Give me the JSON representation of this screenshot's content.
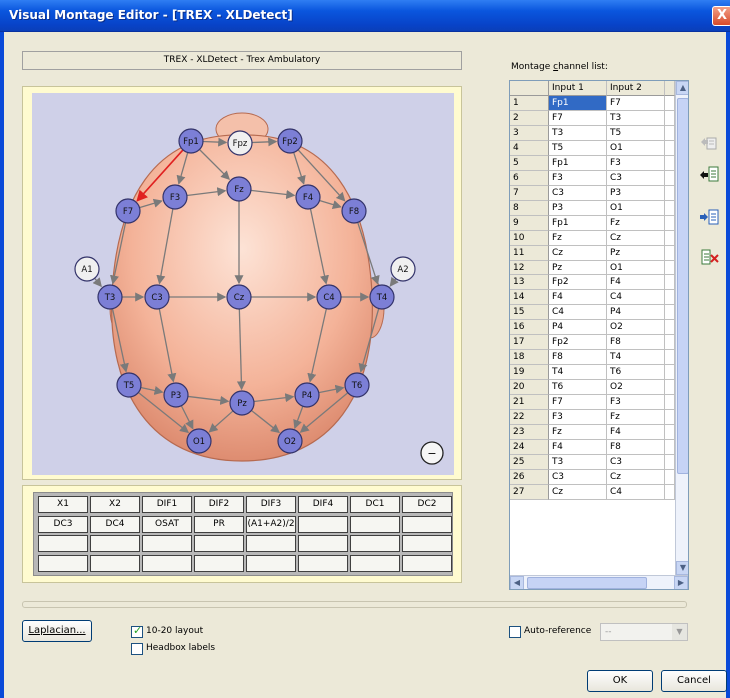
{
  "window": {
    "title": "Visual Montage Editor - [TREX - XLDetect]",
    "close_glyph": "X"
  },
  "headbox_name": "TREX - XLDetect - Trex Ambulatory",
  "colors": {
    "electrode_fill": "#7c7fd6",
    "electrode_ref_fill": "#f0f0f0",
    "head_fill": "#f4b399",
    "canvas_bg": "#cfd0e8",
    "selection": "#316ac5",
    "arrow": "#7a7a7a",
    "arrow_highlight": "#e02020"
  },
  "electrodes": [
    {
      "label": "Fp1",
      "kind": "active"
    },
    {
      "label": "Fpz",
      "kind": "reference"
    },
    {
      "label": "Fp2",
      "kind": "active"
    },
    {
      "label": "F7",
      "kind": "active"
    },
    {
      "label": "F3",
      "kind": "active"
    },
    {
      "label": "Fz",
      "kind": "active"
    },
    {
      "label": "F4",
      "kind": "active"
    },
    {
      "label": "F8",
      "kind": "active"
    },
    {
      "label": "A1",
      "kind": "reference"
    },
    {
      "label": "A2",
      "kind": "reference"
    },
    {
      "label": "T3",
      "kind": "active"
    },
    {
      "label": "C3",
      "kind": "active"
    },
    {
      "label": "Cz",
      "kind": "active"
    },
    {
      "label": "C4",
      "kind": "active"
    },
    {
      "label": "T4",
      "kind": "active"
    },
    {
      "label": "T5",
      "kind": "active"
    },
    {
      "label": "P3",
      "kind": "active"
    },
    {
      "label": "Pz",
      "kind": "active"
    },
    {
      "label": "P4",
      "kind": "active"
    },
    {
      "label": "T6",
      "kind": "active"
    },
    {
      "label": "O1",
      "kind": "active"
    },
    {
      "label": "O2",
      "kind": "active"
    }
  ],
  "ground_symbol": "−",
  "aux_channels": [
    [
      "X1",
      "X2",
      "DIF1",
      "DIF2",
      "DIF3",
      "DIF4",
      "DC1",
      "DC2"
    ],
    [
      "DC3",
      "DC4",
      "OSAT",
      "PR",
      "(A1+A2)/2",
      "",
      "",
      ""
    ],
    [
      "",
      "",
      "",
      "",
      "",
      "",
      "",
      ""
    ],
    [
      "",
      "",
      "",
      "",
      "",
      "",
      "",
      ""
    ]
  ],
  "montage_list": {
    "label_prefix": "Montage ",
    "label_accel": "c",
    "label_suffix": "hannel list:",
    "columns": [
      "",
      "Input 1",
      "Input 2"
    ],
    "rows": [
      [
        "1",
        "Fp1",
        "F7"
      ],
      [
        "2",
        "F7",
        "T3"
      ],
      [
        "3",
        "T3",
        "T5"
      ],
      [
        "4",
        "T5",
        "O1"
      ],
      [
        "5",
        "Fp1",
        "F3"
      ],
      [
        "6",
        "F3",
        "C3"
      ],
      [
        "7",
        "C3",
        "P3"
      ],
      [
        "8",
        "P3",
        "O1"
      ],
      [
        "9",
        "Fp1",
        "Fz"
      ],
      [
        "10",
        "Fz",
        "Cz"
      ],
      [
        "11",
        "Cz",
        "Pz"
      ],
      [
        "12",
        "Pz",
        "O1"
      ],
      [
        "13",
        "Fp2",
        "F4"
      ],
      [
        "14",
        "F4",
        "C4"
      ],
      [
        "15",
        "C4",
        "P4"
      ],
      [
        "16",
        "P4",
        "O2"
      ],
      [
        "17",
        "Fp2",
        "F8"
      ],
      [
        "18",
        "F8",
        "T4"
      ],
      [
        "19",
        "T4",
        "T6"
      ],
      [
        "20",
        "T6",
        "O2"
      ],
      [
        "21",
        "F7",
        "F3"
      ],
      [
        "22",
        "F3",
        "Fz"
      ],
      [
        "23",
        "Fz",
        "F4"
      ],
      [
        "24",
        "F4",
        "F8"
      ],
      [
        "25",
        "T3",
        "C3"
      ],
      [
        "26",
        "C3",
        "Cz"
      ],
      [
        "27",
        "Cz",
        "C4"
      ]
    ],
    "selected_row": 1
  },
  "toolbar_icons": [
    "move-up-icon",
    "insert-before-icon",
    "insert-after-icon",
    "delete-channel-icon"
  ],
  "bottom": {
    "laplacian_label": "Laplacian...",
    "layout_1020_label": "10-20 layout",
    "layout_1020_checked": true,
    "headbox_labels_label": "Headbox labels",
    "headbox_labels_checked": false,
    "auto_reference_label": "Auto-reference",
    "auto_reference_checked": false,
    "auto_reference_value": "--",
    "ok_label": "OK",
    "cancel_label": "Cancel"
  }
}
